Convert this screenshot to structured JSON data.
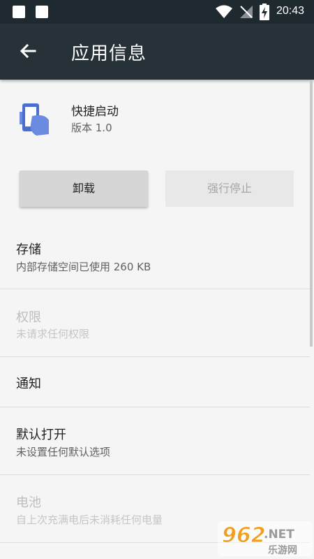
{
  "status_bar": {
    "time": "20:43"
  },
  "app_bar": {
    "title": "应用信息"
  },
  "app": {
    "name": "快捷启动",
    "version": "版本 1.0",
    "icon": "phone-hand-icon",
    "icon_color": "#5b7bd6"
  },
  "buttons": {
    "uninstall": "卸载",
    "force_stop": "强行停止"
  },
  "settings": {
    "storage": {
      "title": "存储",
      "subtitle": "内部存储空间已使用 260 KB"
    },
    "permissions": {
      "title": "权限",
      "subtitle": "未请求任何权限"
    },
    "notifications": {
      "title": "通知"
    },
    "open_by_default": {
      "title": "默认打开",
      "subtitle": "未设置任何默认选项"
    },
    "battery": {
      "title": "电池",
      "subtitle": "自上次充满电后未消耗任何电量"
    }
  },
  "watermark": {
    "brand": "962",
    "suffix": ".NET",
    "tagline": "乐游网"
  },
  "colors": {
    "status_bar": "#1f2a30",
    "app_bar": "#263238",
    "background": "#f5f5f5",
    "watermark_orange": "#f0a020"
  }
}
